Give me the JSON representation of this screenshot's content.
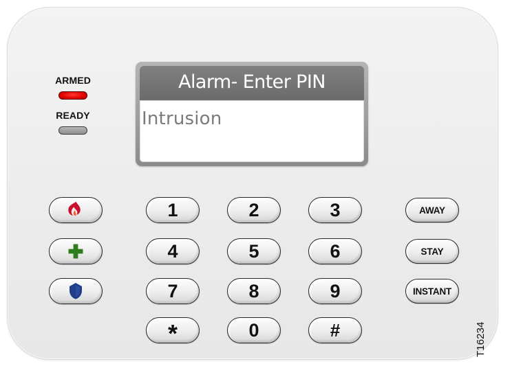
{
  "indicators": {
    "armed": {
      "label": "ARMED",
      "color": "#e00000"
    },
    "ready": {
      "label": "READY",
      "color": "#a3a3a3"
    }
  },
  "display": {
    "title": "Alarm- Enter PIN",
    "line1": "Intrusion"
  },
  "emergency_keys": [
    {
      "name": "fire",
      "icon": "fire-icon",
      "color": "#c8102e"
    },
    {
      "name": "medical",
      "icon": "medical-cross-icon",
      "color": "#2f7d1e"
    },
    {
      "name": "police",
      "icon": "police-shield-icon",
      "color": "#1f3d8a"
    }
  ],
  "number_keys": [
    "1",
    "2",
    "3",
    "4",
    "5",
    "6",
    "7",
    "8",
    "9",
    "*",
    "0",
    "#"
  ],
  "function_keys": [
    "AWAY",
    "STAY",
    "INSTANT"
  ],
  "serial": "T16234"
}
